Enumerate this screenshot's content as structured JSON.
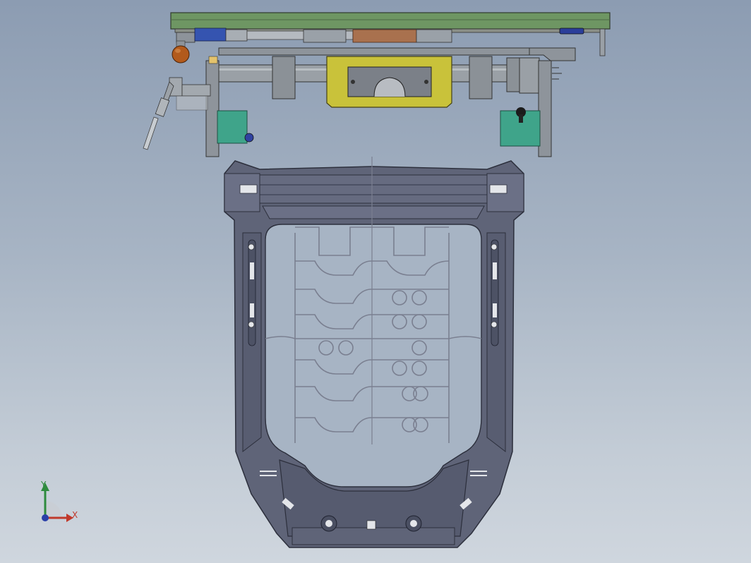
{
  "viewport": {
    "background_top": "#8c9cb2",
    "background_bottom": "#cfd6de"
  },
  "model": {
    "frame_color": "#5f6478",
    "frame_edge_color": "#2c2f3c",
    "fixture_plate_color": "#6b8f5a",
    "center_block_color": "#c9c23a",
    "clamp_block_color": "#3fa48a",
    "rotating_knob_color": "#b25a1c",
    "cylinder_color": "#3b58a8",
    "spring_wire_color": "#7a7f90"
  },
  "triad": {
    "y_label": "Y",
    "x_label": "X",
    "y_color": "#2e8b3e",
    "x_color": "#c0392b",
    "z_color": "#2a3fa8"
  }
}
